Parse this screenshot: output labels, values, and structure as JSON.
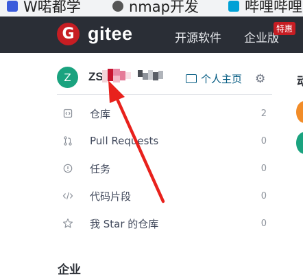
{
  "browser_tabs": [
    {
      "label": "W喏都学",
      "icon": "hackmd-icon",
      "color": "#3b5bdb"
    },
    {
      "label": "nmap开发",
      "icon": "globe-icon",
      "color": "#555555"
    },
    {
      "label": "哔哩哔哩",
      "icon": "bilibili-icon",
      "color": "#00a1d6"
    }
  ],
  "header": {
    "logo_letter": "G",
    "logo_text": "gitee",
    "nav": [
      "开源软件",
      "企业版"
    ],
    "badge": "特惠"
  },
  "profile": {
    "avatar_letter": "Z",
    "username_prefix": "ZS",
    "home_link": "个人主页",
    "settings_icon": "gear-icon"
  },
  "menu": [
    {
      "icon": "repo-icon",
      "label": "仓库",
      "count": "2"
    },
    {
      "icon": "pull-request-icon",
      "label": "Pull Requests",
      "count": "0"
    },
    {
      "icon": "issue-icon",
      "label": "任务",
      "count": "0"
    },
    {
      "icon": "code-snippet-icon",
      "label": "代码片段",
      "count": "0"
    },
    {
      "icon": "star-icon",
      "label": "我 Star 的仓库",
      "count": "0"
    }
  ],
  "section": {
    "title": "企业"
  },
  "right_column": {
    "heading": "动"
  },
  "colors": {
    "brand_red": "#c71d23",
    "topbar": "#2a2e36",
    "avatar": "#1aa37f",
    "link": "#005980",
    "annotation_arrow": "#e8211c"
  }
}
